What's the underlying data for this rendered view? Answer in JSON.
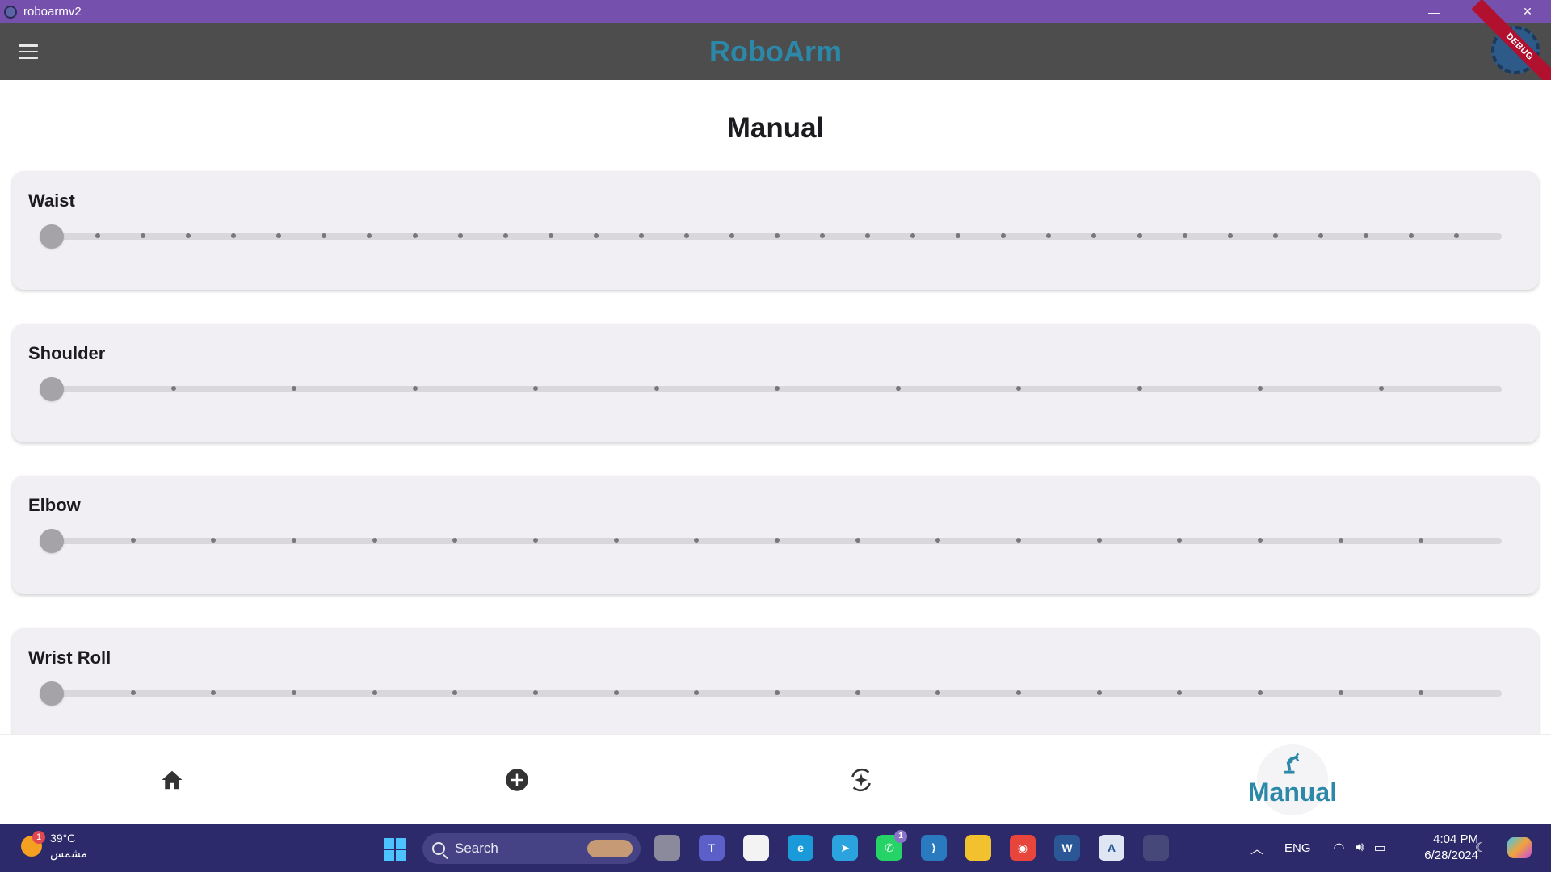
{
  "window": {
    "title": "roboarmv2",
    "minimize": "—",
    "restore": "❐",
    "close": "✕"
  },
  "appbar": {
    "title": "RoboArm",
    "debug_label": "DEBUG"
  },
  "page": {
    "title": "Manual"
  },
  "sliders": [
    {
      "label": "Waist",
      "value": 0,
      "divisions": 32
    },
    {
      "label": "Shoulder",
      "value": 0,
      "divisions": 12
    },
    {
      "label": "Elbow",
      "value": 0,
      "divisions": 18
    },
    {
      "label": "Wrist Roll",
      "value": 0,
      "divisions": 18
    }
  ],
  "bottom_nav": {
    "items": [
      {
        "icon": "home-icon"
      },
      {
        "icon": "add-circle-icon"
      },
      {
        "icon": "ai-scan-icon"
      },
      {
        "icon": "robot-arm-icon",
        "label": "Manual",
        "active": true
      }
    ]
  },
  "taskbar": {
    "weather": {
      "temp": "39°C",
      "condition": "مشمس",
      "badge": "1"
    },
    "search_placeholder": "Search",
    "apps": [
      {
        "name": "task-view",
        "color": "#8a8a9c"
      },
      {
        "name": "teams",
        "color": "#5b5fc7",
        "glyph": "T"
      },
      {
        "name": "store",
        "color": "#f3f3f3"
      },
      {
        "name": "edge",
        "color": "#1a9ad8",
        "glyph": "e"
      },
      {
        "name": "telegram",
        "color": "#2aa3df",
        "glyph": "➤"
      },
      {
        "name": "whatsapp",
        "color": "#25d366",
        "glyph": "✆",
        "badge": "1"
      },
      {
        "name": "vscode",
        "color": "#2a7ac0",
        "glyph": "⟩"
      },
      {
        "name": "file-explorer",
        "color": "#f2c12e"
      },
      {
        "name": "chrome",
        "color": "#e8453c",
        "glyph": "◉"
      },
      {
        "name": "word",
        "color": "#2b5797",
        "glyph": "W"
      },
      {
        "name": "app-store",
        "color": "#dfe6f3",
        "glyph": "A"
      },
      {
        "name": "roboarm-app",
        "color": "#46487a"
      }
    ],
    "language": "ENG",
    "time": "4:04 PM",
    "date": "6/28/2024"
  },
  "colors": {
    "title_bar": "#7650ad",
    "app_bar": "#4d4d4d",
    "accent": "#2c88a8",
    "card": "#f1eef4",
    "taskbar": "#2c2a6a"
  }
}
